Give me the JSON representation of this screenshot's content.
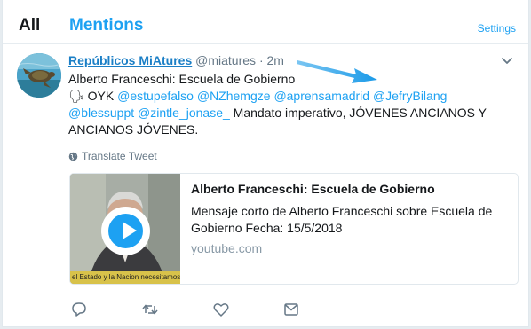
{
  "tabs": {
    "all": "All",
    "mentions": "Mentions",
    "settings": "Settings"
  },
  "tweet": {
    "author_name": "Repúblicos MiAtures",
    "author_handle": "@miatures",
    "separator": "·",
    "time": "2m",
    "line1": "Alberto Franceschi: Escuela de Gobierno",
    "speaker_emoji": "🗣",
    "oyk": "OYK",
    "mentions": [
      "@estupefalso",
      "@NZhemgze",
      "@aprensamadrid",
      "@JefryBilang",
      "@blessuppt",
      "@zintle_jonase_"
    ],
    "text_tail": "Mandato imperativo, JÓVENES ANCIANOS Y ANCIANOS JÓVENES.",
    "translate": "Translate Tweet"
  },
  "card": {
    "title": "Alberto Franceschi: Escuela de Gobierno",
    "description": "Mensaje corto de Alberto Franceschi sobre Escuela de Gobierno Fecha: 15/5/2018",
    "domain": "youtube.com",
    "ticker": "el Estado y la Nacion necesitamos una Escu"
  },
  "actions": [
    "reply-icon",
    "retweet-icon",
    "like-icon",
    "message-icon"
  ],
  "colors": {
    "accent": "#1da1f2",
    "name_link": "#1b7fc6",
    "muted": "#657786",
    "annotation_arrow": "#1a9ae8"
  }
}
